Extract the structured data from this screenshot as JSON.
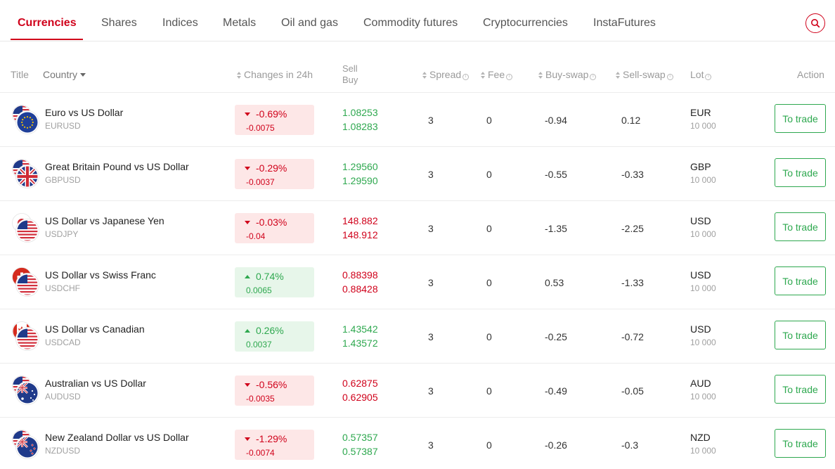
{
  "tabs": [
    {
      "label": "Currencies",
      "active": true
    },
    {
      "label": "Shares"
    },
    {
      "label": "Indices"
    },
    {
      "label": "Metals"
    },
    {
      "label": "Oil and gas"
    },
    {
      "label": "Commodity futures"
    },
    {
      "label": "Cryptocurrencies"
    },
    {
      "label": "InstaFutures"
    }
  ],
  "search": {
    "icon": "search-icon"
  },
  "colors": {
    "accent": "#d0021b",
    "up": "#2ea84f",
    "down": "#d0021b"
  },
  "columns": {
    "title": "Title",
    "country": "Country",
    "changes": "Changes in 24h",
    "sell": "Sell",
    "buy": "Buy",
    "spread": "Spread",
    "fee": "Fee",
    "buy_swap": "Buy-swap",
    "sell_swap": "Sell-swap",
    "lot": "Lot",
    "action": "Action"
  },
  "rows": [
    {
      "name": "Euro vs US Dollar",
      "symbol": "EURUSD",
      "flag": "eu-us-flag",
      "dir": "down",
      "change_pct": "-0.69%",
      "change_abs": "-0.0075",
      "sell": "1.08253",
      "buy": "1.08283",
      "price_dir": "up",
      "spread": "3",
      "fee": "0",
      "buy_swap": "-0.94",
      "sell_swap": "0.12",
      "lot_currency": "EUR",
      "lot_size": "10 000",
      "action": "To trade"
    },
    {
      "name": "Great Britain Pound vs US Dollar",
      "symbol": "GBPUSD",
      "flag": "gb-us-flag",
      "dir": "down",
      "change_pct": "-0.29%",
      "change_abs": "-0.0037",
      "sell": "1.29560",
      "buy": "1.29590",
      "price_dir": "up",
      "spread": "3",
      "fee": "0",
      "buy_swap": "-0.55",
      "sell_swap": "-0.33",
      "lot_currency": "GBP",
      "lot_size": "10 000",
      "action": "To trade"
    },
    {
      "name": "US Dollar vs Japanese Yen",
      "symbol": "USDJPY",
      "flag": "us-jp-flag",
      "dir": "down",
      "change_pct": "-0.03%",
      "change_abs": "-0.04",
      "sell": "148.882",
      "buy": "148.912",
      "price_dir": "down",
      "spread": "3",
      "fee": "0",
      "buy_swap": "-1.35",
      "sell_swap": "-2.25",
      "lot_currency": "USD",
      "lot_size": "10 000",
      "action": "To trade"
    },
    {
      "name": "US Dollar vs Swiss Franc",
      "symbol": "USDCHF",
      "flag": "us-ch-flag",
      "dir": "up",
      "change_pct": "0.74%",
      "change_abs": "0.0065",
      "sell": "0.88398",
      "buy": "0.88428",
      "price_dir": "down",
      "spread": "3",
      "fee": "0",
      "buy_swap": "0.53",
      "sell_swap": "-1.33",
      "lot_currency": "USD",
      "lot_size": "10 000",
      "action": "To trade"
    },
    {
      "name": "US Dollar vs Canadian",
      "symbol": "USDCAD",
      "flag": "us-ca-flag",
      "dir": "up",
      "change_pct": "0.26%",
      "change_abs": "0.0037",
      "sell": "1.43542",
      "buy": "1.43572",
      "price_dir": "up",
      "spread": "3",
      "fee": "0",
      "buy_swap": "-0.25",
      "sell_swap": "-0.72",
      "lot_currency": "USD",
      "lot_size": "10 000",
      "action": "To trade"
    },
    {
      "name": "Australian vs US Dollar",
      "symbol": "AUDUSD",
      "flag": "au-us-flag",
      "dir": "down",
      "change_pct": "-0.56%",
      "change_abs": "-0.0035",
      "sell": "0.62875",
      "buy": "0.62905",
      "price_dir": "down",
      "spread": "3",
      "fee": "0",
      "buy_swap": "-0.49",
      "sell_swap": "-0.05",
      "lot_currency": "AUD",
      "lot_size": "10 000",
      "action": "To trade"
    },
    {
      "name": "New Zealand Dollar vs US Dollar",
      "symbol": "NZDUSD",
      "flag": "nz-us-flag",
      "dir": "down",
      "change_pct": "-1.29%",
      "change_abs": "-0.0074",
      "sell": "0.57357",
      "buy": "0.57387",
      "price_dir": "up",
      "spread": "3",
      "fee": "0",
      "buy_swap": "-0.26",
      "sell_swap": "-0.3",
      "lot_currency": "NZD",
      "lot_size": "10 000",
      "action": "To trade"
    }
  ]
}
